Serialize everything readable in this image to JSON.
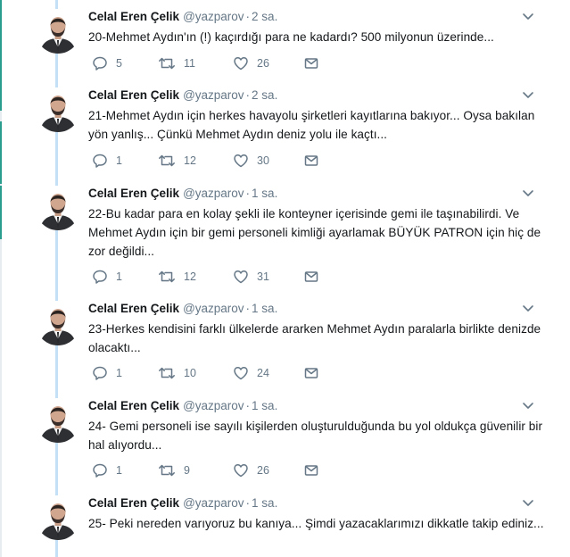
{
  "theme": {
    "thread_line_color": "#c4e0f7",
    "muted_color": "#657786",
    "text_color": "#14171a"
  },
  "tweets": [
    {
      "name": "Celal Eren Çelik",
      "handle": "@yazparov",
      "dot": "·",
      "time": "2 sa.",
      "text": "20-Mehmet Aydın'ın (!) kaçırdığı para ne kadardı? 500 milyonun üzerinde...",
      "replies": "5",
      "retweets": "11",
      "likes": "26"
    },
    {
      "name": "Celal Eren Çelik",
      "handle": "@yazparov",
      "dot": "·",
      "time": "2 sa.",
      "text": "21-Mehmet Aydın için herkes havayolu şirketleri kayıtlarına bakıyor... Oysa bakılan yön yanlış... Çünkü Mehmet Aydın deniz yolu ile kaçtı...",
      "replies": "1",
      "retweets": "12",
      "likes": "30"
    },
    {
      "name": "Celal Eren Çelik",
      "handle": "@yazparov",
      "dot": "·",
      "time": "1 sa.",
      "text": "22-Bu kadar para en kolay şekli ile konteyner içerisinde gemi ile taşınabilirdi. Ve Mehmet Aydın için bir gemi personeli kimliği ayarlamak BÜYÜK PATRON için hiç de zor değildi...",
      "replies": "1",
      "retweets": "12",
      "likes": "31"
    },
    {
      "name": "Celal Eren Çelik",
      "handle": "@yazparov",
      "dot": "·",
      "time": "1 sa.",
      "text": "23-Herkes kendisini farklı ülkelerde ararken Mehmet Aydın paralarla birlikte denizde olacaktı...",
      "replies": "1",
      "retweets": "10",
      "likes": "24"
    },
    {
      "name": "Celal Eren Çelik",
      "handle": "@yazparov",
      "dot": "·",
      "time": "1 sa.",
      "text": "24- Gemi personeli ise sayılı kişilerden oluşturulduğunda bu yol oldukça güvenilir bir hal alıyordu...",
      "replies": "1",
      "retweets": "9",
      "likes": "26"
    },
    {
      "name": "Celal Eren Çelik",
      "handle": "@yazparov",
      "dot": "·",
      "time": "1 sa.",
      "text": "25- Peki nereden varıyoruz bu kanıya... Şimdi yazacaklarımızı dikkatle takip ediniz..."
    }
  ]
}
